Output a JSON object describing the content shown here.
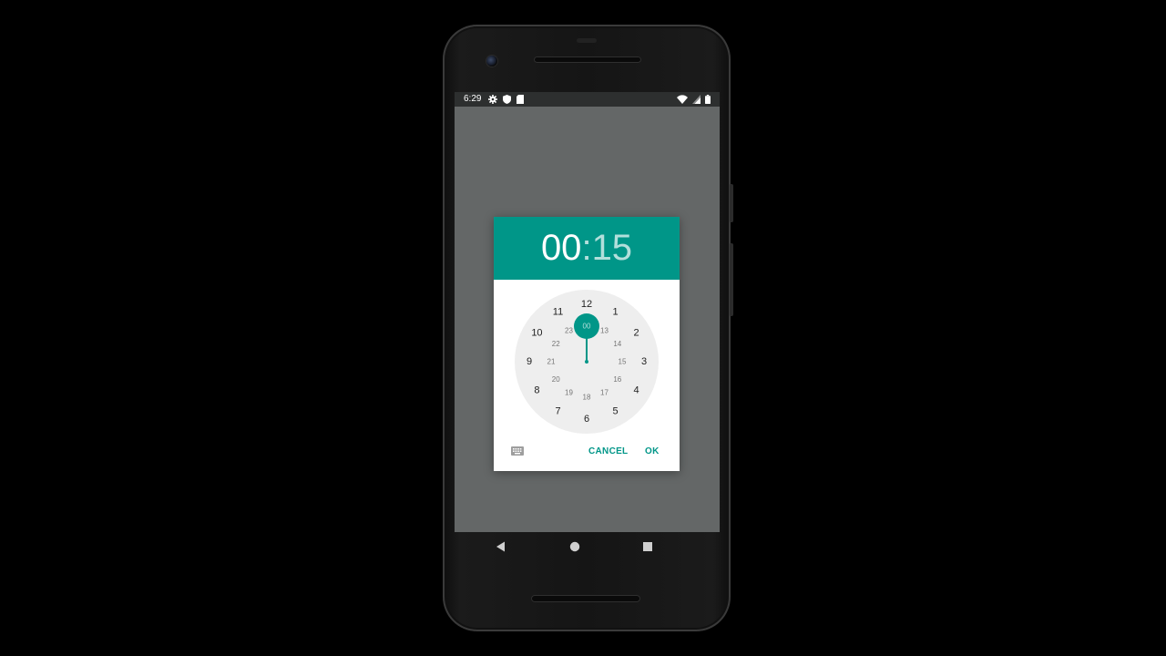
{
  "status_bar": {
    "time": "6:29",
    "left_icons": [
      "gear-icon",
      "shield-icon",
      "sd-card-icon"
    ],
    "right_icons": [
      "wifi-icon",
      "cell-signal-icon",
      "battery-icon"
    ]
  },
  "time_picker": {
    "hour": "00",
    "separator": ":",
    "minute": "15",
    "selected_mode": "hour",
    "selected_value": "00",
    "outer_ring": [
      "12",
      "1",
      "2",
      "3",
      "4",
      "5",
      "6",
      "7",
      "8",
      "9",
      "10",
      "11"
    ],
    "inner_ring": [
      "00",
      "13",
      "14",
      "15",
      "16",
      "17",
      "18",
      "19",
      "20",
      "21",
      "22",
      "23"
    ],
    "colors": {
      "accent": "#009688",
      "accent_light": "#b2dfdb",
      "clock_face": "#eeeeee"
    }
  },
  "actions": {
    "keyboard_icon": "keyboard-icon",
    "cancel_label": "CANCEL",
    "ok_label": "OK"
  },
  "nav_bar": {
    "buttons": [
      "back-icon",
      "home-icon",
      "recents-icon"
    ]
  }
}
